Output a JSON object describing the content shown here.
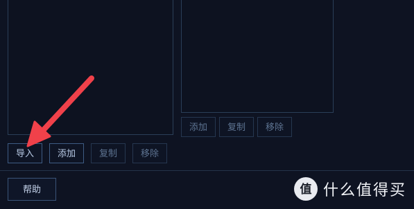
{
  "left_panel": {
    "buttons": {
      "import": "导入",
      "add": "添加",
      "copy": "复制",
      "remove": "移除"
    }
  },
  "right_panel": {
    "buttons": {
      "add": "添加",
      "copy": "复制",
      "remove": "移除"
    }
  },
  "footer": {
    "help": "帮助"
  },
  "watermark": {
    "text": "什么值得买",
    "logo_char": "值"
  },
  "annotation": {
    "arrow_color": "#f0414a"
  },
  "colors": {
    "background": "#0e1322",
    "panel_border": "#2a3f58",
    "button_text": "#7e95b2"
  }
}
